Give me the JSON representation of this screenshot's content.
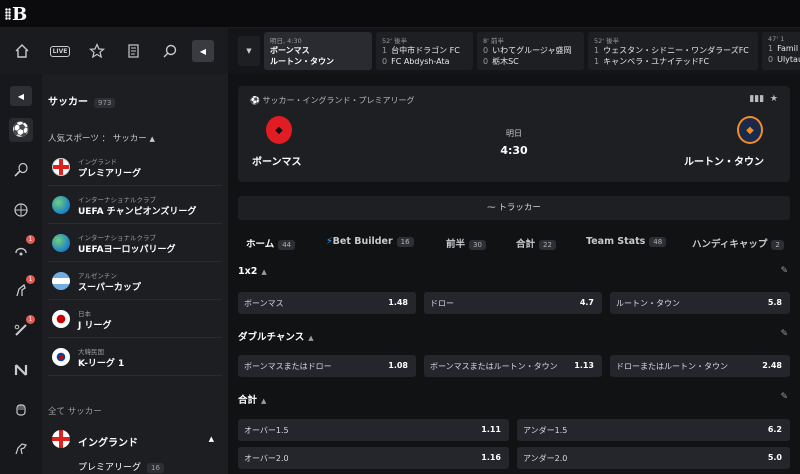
{
  "app": {
    "logo": "B"
  },
  "iconbar": {
    "live_label": "LIVE"
  },
  "sidebar": {
    "title": "サッカー",
    "title_count": "973",
    "popular_label": "人気スポーツ ： サッカー",
    "leagues": [
      {
        "country": "イングランド",
        "name": "プレミアリーグ"
      },
      {
        "country": "インターナショナルクラブ",
        "name": "UEFA チャンピオンズリーグ"
      },
      {
        "country": "インターナショナルクラブ",
        "name": "UEFAヨーロッパリーグ"
      },
      {
        "country": "アルゼンチン",
        "name": "スーパーカップ"
      },
      {
        "country": "日本",
        "name": "J リーグ"
      },
      {
        "country": "大韓民国",
        "name": "K-リーグ 1"
      }
    ],
    "all_label": "全て サッカー",
    "country_row": "イングランド",
    "sub_league": "プレミアリーグ",
    "sub_league_count": "16"
  },
  "rail_badges": [
    "1",
    "1",
    "1"
  ],
  "strip": [
    {
      "time": "明日, 4:30",
      "home": "ボーンマス",
      "away": "ルートン・タウン",
      "hs": "",
      "as": ""
    },
    {
      "time": "52' 後半",
      "home": "台中市ドラゴン FC",
      "away": "FC Abdysh-Ata",
      "hs": "1",
      "as": "0"
    },
    {
      "time": "8' 前半",
      "home": "いわてグルージャ盛岡",
      "away": "栃木SC",
      "hs": "0",
      "as": "0"
    },
    {
      "time": "52' 後半",
      "home": "ウェスタン・シドニー・ワンダラーズFC",
      "away": "キャンベラ・ユナイテッドFC",
      "hs": "1",
      "as": "1"
    },
    {
      "time": "47' 1",
      "home": "Famil",
      "away": "Ulytau",
      "hs": "1",
      "as": "0"
    }
  ],
  "match": {
    "competition": "サッカー・イングランド・プレミアリーグ",
    "home": "ボーンマス",
    "away": "ルートン・タウン",
    "date": "明日",
    "time": "4:30"
  },
  "tracker_label": "トラッカー",
  "tabs": [
    {
      "label": "ホーム",
      "count": "44"
    },
    {
      "label": "Bet Builder",
      "count": "16"
    },
    {
      "label": "前半",
      "count": "30"
    },
    {
      "label": "合計",
      "count": "22"
    },
    {
      "label": "Team Stats",
      "count": "48"
    },
    {
      "label": "ハンディキャップ",
      "count": "2"
    }
  ],
  "markets": {
    "m1x2": {
      "title": "1x2",
      "odds": [
        {
          "label": "ボーンマス",
          "value": "1.48"
        },
        {
          "label": "ドロー",
          "value": "4.7"
        },
        {
          "label": "ルートン・タウン",
          "value": "5.8"
        }
      ]
    },
    "double": {
      "title": "ダブルチャンス",
      "odds": [
        {
          "label": "ボーンマスまたはドロー",
          "value": "1.08"
        },
        {
          "label": "ボーンマスまたはルートン・タウン",
          "value": "1.13"
        },
        {
          "label": "ドローまたはルートン・タウン",
          "value": "2.48"
        }
      ]
    },
    "total": {
      "title": "合計",
      "odds": [
        {
          "label": "オーバー1.5",
          "value": "1.11"
        },
        {
          "label": "アンダー1.5",
          "value": "6.2"
        },
        {
          "label": "オーバー2.0",
          "value": "1.16"
        },
        {
          "label": "アンダー2.0",
          "value": "5.0"
        }
      ]
    }
  }
}
